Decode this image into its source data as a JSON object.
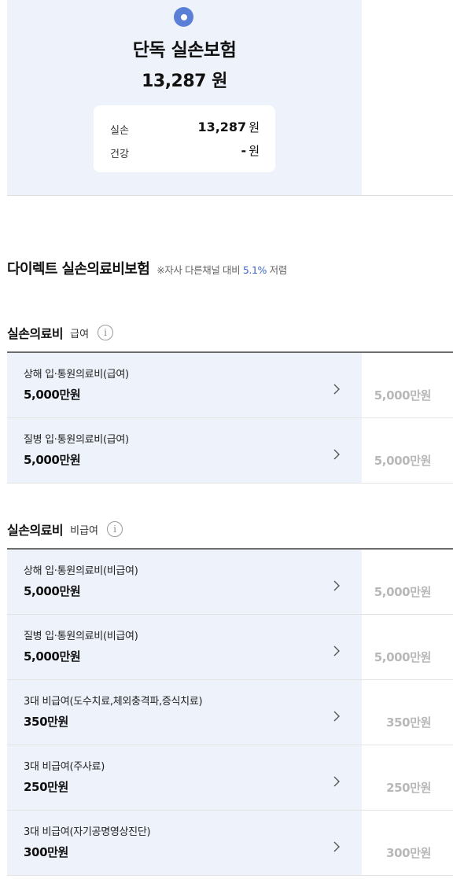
{
  "plan": {
    "title": "단독 실손보험",
    "price": "13,287",
    "price_unit": "원",
    "breakdown": [
      {
        "label": "실손",
        "value": "13,287",
        "unit": "원"
      },
      {
        "label": "건강",
        "value": "-",
        "unit": "원"
      }
    ],
    "radio_selected": true
  },
  "product": {
    "name": "다이렉트 실손의료비보험",
    "note_prefix": "※자사 다른채널 대비 ",
    "note_pct": "5.1%",
    "note_suffix": " 저렴"
  },
  "sections": [
    {
      "title": "실손의료비",
      "sub": "급여",
      "info_icon": "i",
      "rows": [
        {
          "name": "상해 입·통원의료비(급여)",
          "amount": "5,000만원",
          "compare": "5,000만원"
        },
        {
          "name": "질병 입·통원의료비(급여)",
          "amount": "5,000만원",
          "compare": "5,000만원"
        }
      ]
    },
    {
      "title": "실손의료비",
      "sub": "비급여",
      "info_icon": "i",
      "rows": [
        {
          "name": "상해 입·통원의료비(비급여)",
          "amount": "5,000만원",
          "compare": "5,000만원"
        },
        {
          "name": "질병 입·통원의료비(비급여)",
          "amount": "5,000만원",
          "compare": "5,000만원"
        },
        {
          "name": "3대 비급여(도수치료,체외충격파,증식치료)",
          "amount": "350만원",
          "compare": "350만원"
        },
        {
          "name": "3대 비급여(주사료)",
          "amount": "250만원",
          "compare": "250만원"
        },
        {
          "name": "3대 비급여(자기공명영상진단)",
          "amount": "300만원",
          "compare": "300만원"
        }
      ]
    }
  ],
  "colors": {
    "accent": "#5a7fd6",
    "panel_bg": "#eef2fb",
    "highlight_text": "#3f64c7",
    "muted_text": "#b8b8b8"
  },
  "icons": {
    "radio": "radio-selected-icon",
    "info": "info-icon",
    "row_arrow": "chevron-right-icon"
  }
}
